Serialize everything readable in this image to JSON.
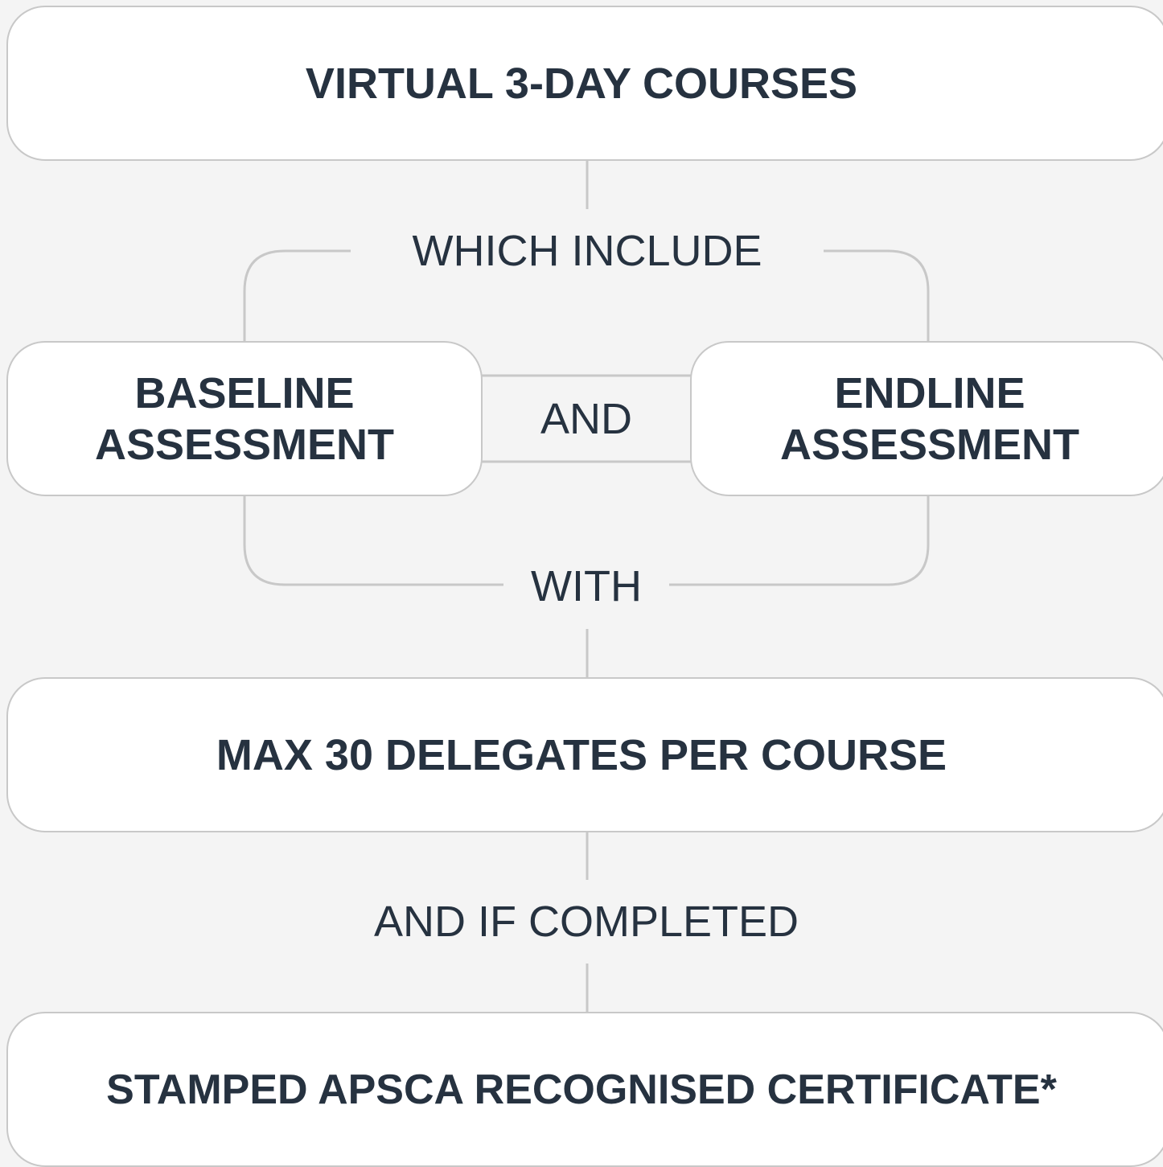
{
  "boxes": {
    "top": "VIRTUAL 3-DAY COURSES",
    "baseline": [
      "BASELINE",
      "ASSESSMENT"
    ],
    "endline": [
      "ENDLINE",
      "ASSESSMENT"
    ],
    "delegates": "MAX 30 DELEGATES PER COURSE",
    "certificate": "STAMPED APSCA RECOGNISED CERTIFICATE*"
  },
  "connectors": {
    "which_include": "WHICH INCLUDE",
    "and": "AND",
    "with": "WITH",
    "and_if_completed": "AND IF COMPLETED"
  },
  "colors": {
    "background": "#f4f4f4",
    "box_fill": "#ffffff",
    "border": "#c8c8c8",
    "text": "#263240"
  }
}
